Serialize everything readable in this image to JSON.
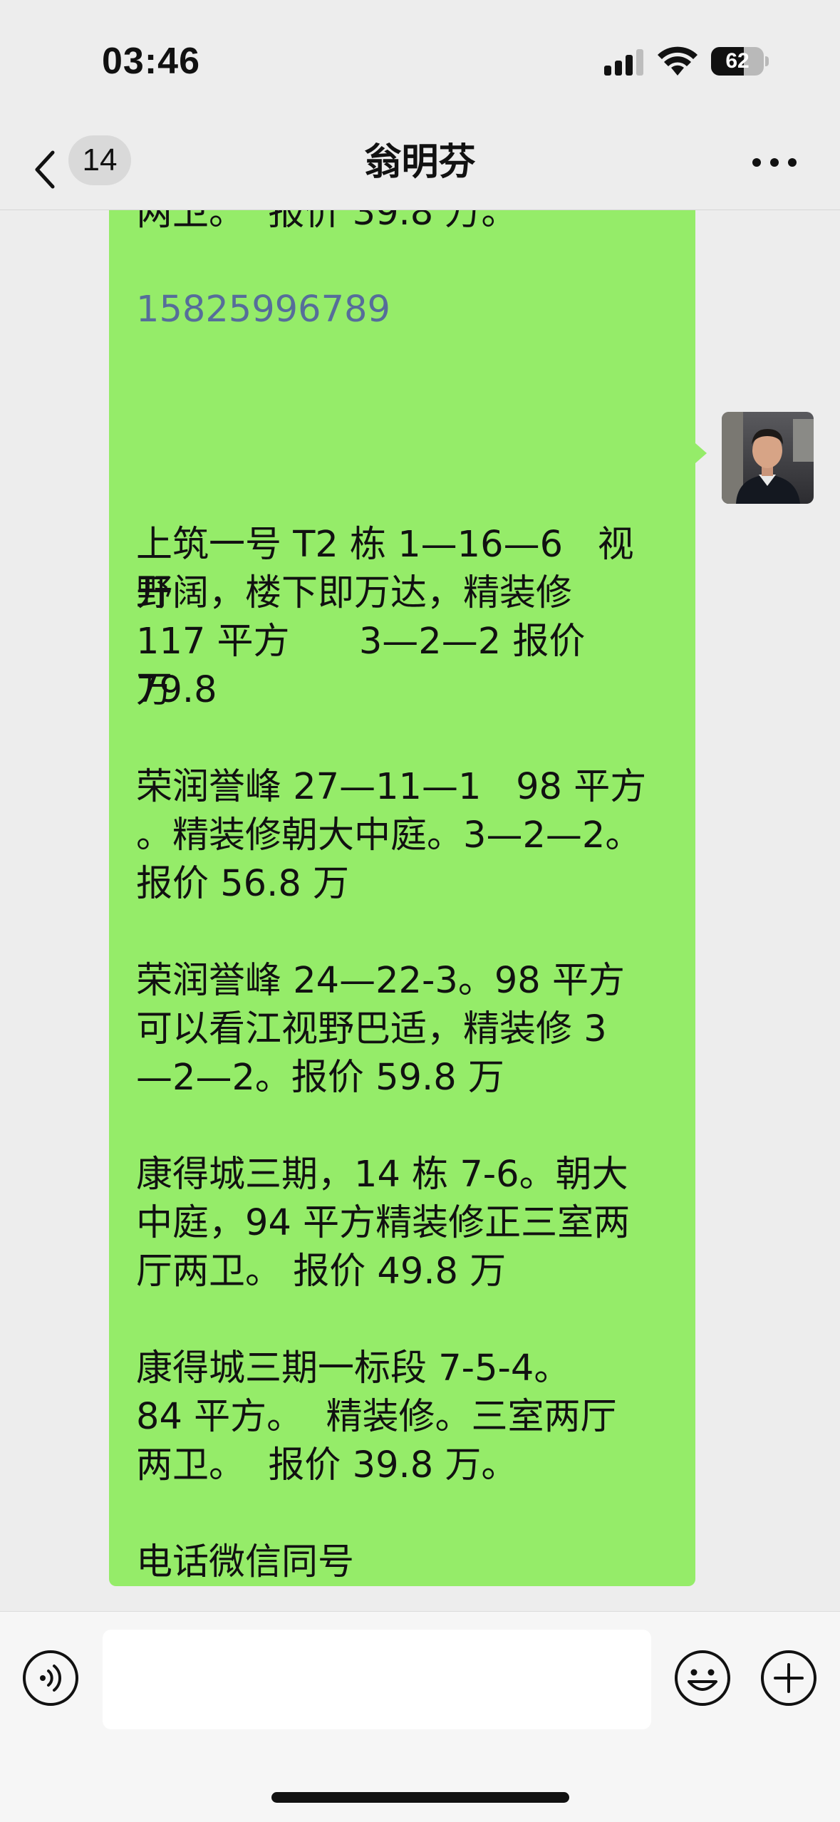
{
  "status_bar": {
    "time": "03:46",
    "battery_percent": "62",
    "battery_level": 0.62
  },
  "nav": {
    "unread_count": "14",
    "title": "翁明芬"
  },
  "messages": {
    "previous_tail": "两卫。  报价 39.8 万。",
    "previous_phone": "15825996789",
    "listing_lines": [
      "上筑一号 T2 栋 1—16—6   视野",
      "开阔，楼下即万达，精装修",
      "117 平方      3—2—2 报价 79.8",
      "万",
      "",
      "荣润誉峰 27—11—1   98 平方",
      "。精装修朝大中庭。3—2—2。",
      "报价 56.8 万",
      "",
      "荣润誉峰 24—22-3。98 平方",
      "可以看江视野巴适，精装修 3",
      "—2—2。报价 59.8 万",
      "",
      "康得城三期，14 栋 7-6。朝大",
      "中庭，94 平方精装修正三室两",
      "厅两卫。 报价 49.8 万",
      "",
      "康得城三期一标段 7-5-4。",
      "84 平方。  精装修。三室两厅",
      "两卫。  报价 39.8 万。",
      "",
      "电话微信同号"
    ],
    "phone": "15825996789"
  },
  "input": {
    "value": ""
  },
  "colors": {
    "bubble": "#95ec69",
    "link": "#566d9a",
    "background": "#ededed"
  }
}
